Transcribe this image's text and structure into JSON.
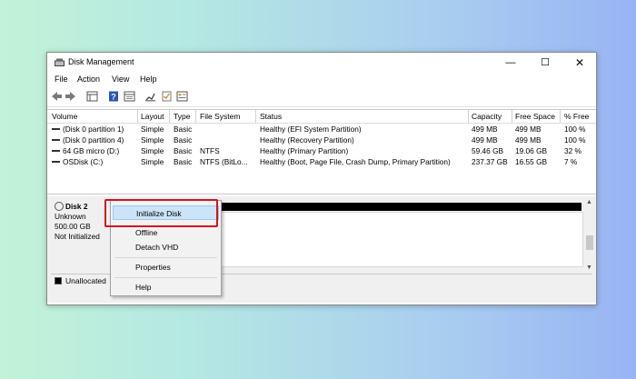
{
  "window": {
    "title": "Disk Management",
    "controls": {
      "minimize": "—",
      "maximize": "☐",
      "close": "✕"
    }
  },
  "menubar": {
    "items": [
      "File",
      "Action",
      "View",
      "Help"
    ]
  },
  "toolbar": {
    "icons": [
      "back-icon",
      "forward-icon",
      "disk-list-icon",
      "help-icon",
      "console-icon",
      "rescan-icon",
      "checklist-icon",
      "properties-icon"
    ]
  },
  "volumes": {
    "columns": [
      "Volume",
      "Layout",
      "Type",
      "File System",
      "Status",
      "Capacity",
      "Free Space",
      "% Free"
    ],
    "rows": [
      {
        "volume": "(Disk 0 partition 1)",
        "layout": "Simple",
        "type": "Basic",
        "fs": "",
        "status": "Healthy (EFI System Partition)",
        "capacity": "499 MB",
        "free": "499 MB",
        "pct": "100 %"
      },
      {
        "volume": "(Disk 0 partition 4)",
        "layout": "Simple",
        "type": "Basic",
        "fs": "",
        "status": "Healthy (Recovery Partition)",
        "capacity": "499 MB",
        "free": "499 MB",
        "pct": "100 %"
      },
      {
        "volume": "64 GB micro (D:)",
        "layout": "Simple",
        "type": "Basic",
        "fs": "NTFS",
        "status": "Healthy (Primary Partition)",
        "capacity": "59.46 GB",
        "free": "19.06 GB",
        "pct": "32 %"
      },
      {
        "volume": "OSDisk (C:)",
        "layout": "Simple",
        "type": "Basic",
        "fs": "NTFS (BitLo...",
        "status": "Healthy (Boot, Page File, Crash Dump, Primary Partition)",
        "capacity": "237.37 GB",
        "free": "16.55 GB",
        "pct": "7 %"
      }
    ]
  },
  "disk": {
    "name": "Disk 2",
    "type": "Unknown",
    "size": "500.00 GB",
    "state": "Not Initialized"
  },
  "legend": {
    "unallocated": "Unallocated"
  },
  "context_menu": {
    "items": [
      "Initialize Disk",
      "Offline",
      "Detach VHD",
      "Properties",
      "Help"
    ],
    "highlighted": "Initialize Disk"
  },
  "colors": {
    "highlight_border": "#d4121c",
    "menu_highlight": "#cce4f7"
  }
}
